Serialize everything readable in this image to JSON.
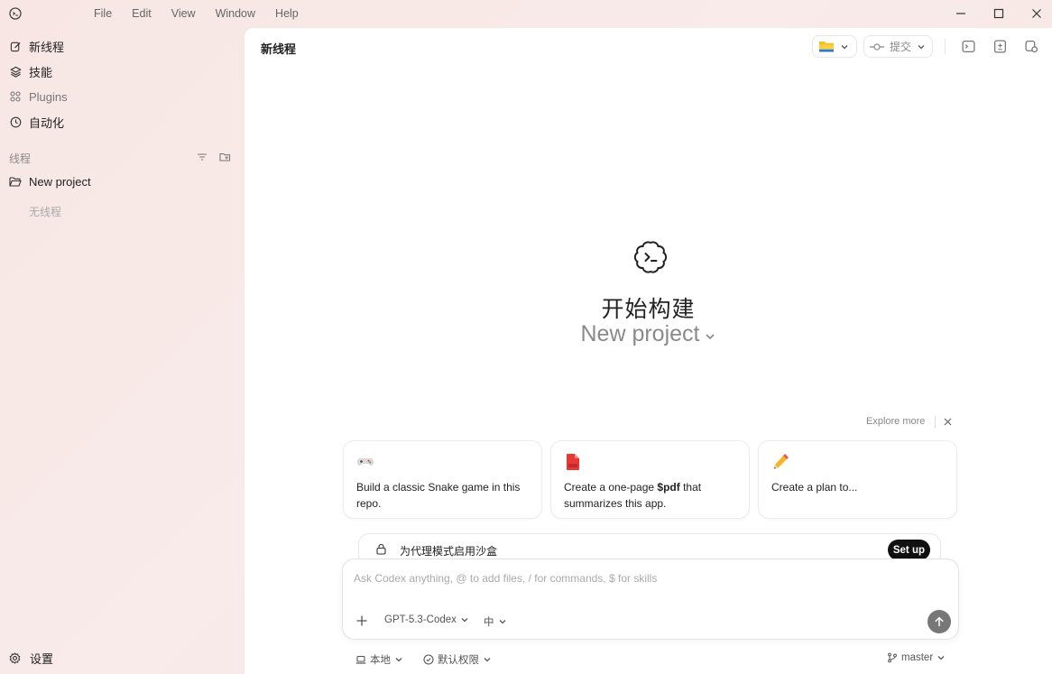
{
  "menu": [
    "File",
    "Edit",
    "View",
    "Window",
    "Help"
  ],
  "sidebar": {
    "nav": [
      {
        "label": "新线程",
        "icon": "edit-icon"
      },
      {
        "label": "技能",
        "icon": "skills-icon"
      },
      {
        "label": "Plugins",
        "icon": "plugins-icon"
      },
      {
        "label": "自动化",
        "icon": "clock-icon"
      }
    ],
    "section_label": "线程",
    "project": "New project",
    "no_threads": "无线程",
    "settings": "设置"
  },
  "main": {
    "title": "新线程",
    "commit_label": "提交",
    "hero_title": "开始构建",
    "hero_project": "New project",
    "explore": "Explore more",
    "cards": [
      {
        "text": "Build a classic Snake game in this repo.",
        "icon": "gamepad-icon"
      },
      {
        "pre": "Create a one-page ",
        "bold": "$pdf",
        "post": " that summarizes this app.",
        "icon": "pdf-icon"
      },
      {
        "text": "Create a plan to...",
        "icon": "pencil-icon"
      }
    ],
    "sandbox": {
      "text": "为代理模式启用沙盒",
      "button": "Set up"
    },
    "composer": {
      "placeholder": "Ask Codex anything, @ to add files, / for commands, $ for skills",
      "model": "GPT-5.3-Codex",
      "effort": "中"
    },
    "footer": {
      "local": "本地",
      "permissions": "默认权限",
      "branch": "master"
    }
  },
  "colors": {
    "accent_dark": "#111111",
    "sidebar_bg": "#f7e6e4",
    "folder_yellow": "#f5c024",
    "pdf_red": "#e53935"
  }
}
